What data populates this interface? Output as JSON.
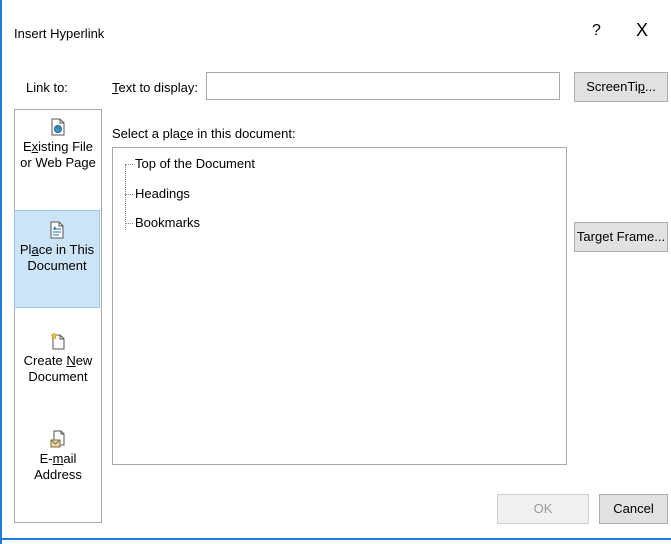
{
  "dialog": {
    "title": "Insert Hyperlink",
    "help": "?",
    "close": "X"
  },
  "link_to": {
    "label": "Link to:",
    "items": [
      {
        "pre": "E",
        "u": "x",
        "post": "isting File",
        "line2": "or Web Page",
        "icon": "web-page-icon",
        "selected": false
      },
      {
        "pre": "Pl",
        "u": "a",
        "post": "ce in This",
        "line2": "Document",
        "icon": "place-in-document-icon",
        "selected": true
      },
      {
        "pre": "Create ",
        "u": "N",
        "post": "ew",
        "line2": "Document",
        "icon": "new-document-icon",
        "selected": false
      },
      {
        "pre": "E-",
        "u": "m",
        "post": "ail",
        "line2": "Address",
        "icon": "email-icon",
        "selected": false
      }
    ]
  },
  "text_to_display": {
    "label_u": "T",
    "label_rest": "ext to display:",
    "value": "",
    "placeholder": ""
  },
  "place": {
    "label_pre": "Select a pla",
    "label_u": "c",
    "label_post": "e in this document:",
    "tree": [
      "Top of the Document",
      "Headings",
      "Bookmarks"
    ]
  },
  "buttons": {
    "screentip_pre": "ScreenTi",
    "screentip_u": "p",
    "screentip_post": "...",
    "target_pre": "Tar",
    "target_u": "g",
    "target_post": "et Frame...",
    "ok": "OK",
    "cancel": "Cancel"
  }
}
